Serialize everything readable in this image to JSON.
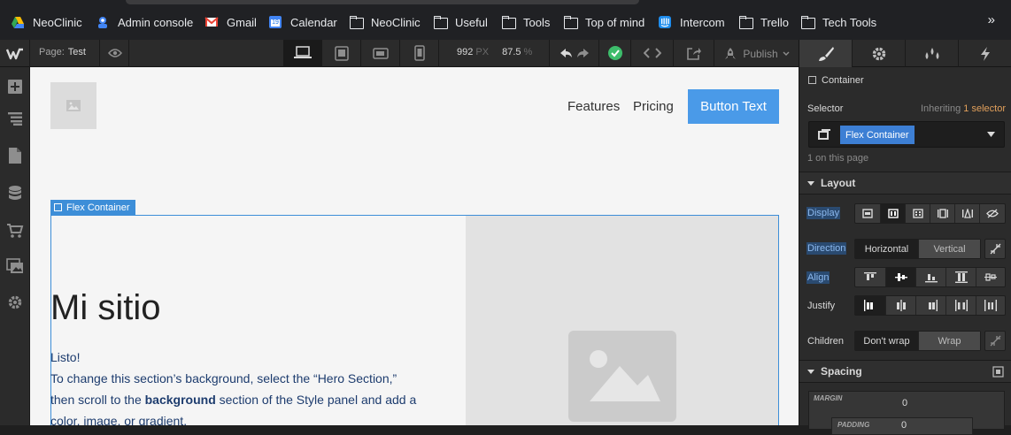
{
  "bookmarks": [
    {
      "label": "NeoClinic",
      "icon": "google-drive-icon"
    },
    {
      "label": "Admin console",
      "icon": "admin-console-icon"
    },
    {
      "label": "Gmail",
      "icon": "gmail-icon"
    },
    {
      "label": "Calendar",
      "icon": "calendar-icon",
      "badge": "19"
    },
    {
      "label": "NeoClinic",
      "icon": "folder-icon"
    },
    {
      "label": "Useful",
      "icon": "folder-icon"
    },
    {
      "label": "Tools",
      "icon": "folder-icon"
    },
    {
      "label": "Top of mind",
      "icon": "folder-icon"
    },
    {
      "label": "Intercom",
      "icon": "intercom-icon"
    },
    {
      "label": "Trello",
      "icon": "folder-icon"
    },
    {
      "label": "Tech Tools",
      "icon": "folder-icon"
    }
  ],
  "bookmarks_more": "»",
  "toolbar": {
    "page_label": "Page:",
    "page_name": "Test",
    "width_value": "992",
    "width_unit": "PX",
    "zoom_value": "87.5",
    "zoom_unit": "%",
    "publish_label": "Publish"
  },
  "canvas": {
    "nav_links": [
      "Features",
      "Pricing"
    ],
    "button_text": "Button Text",
    "selected_tag": "Flex Container",
    "hero_title": "Mi sitio",
    "hero_line1": "Listo!",
    "hero_line2": "To change this section’s background, select the “Hero Section,”",
    "hero_line3a": "then scroll to the ",
    "hero_line3b": "background",
    "hero_line3c": " section of the Style panel and add a",
    "hero_line4": "color, image, or gradient."
  },
  "style_panel": {
    "element_label": "Container",
    "selector_label": "Selector",
    "inheriting_label": "Inheriting",
    "inheriting_count": "1 selector",
    "selector_chip": "Flex Container",
    "on_page": "1 on this page",
    "layout_header": "Layout",
    "display_label": "Display",
    "direction_label": "Direction",
    "direction_options": [
      "Horizontal",
      "Vertical"
    ],
    "align_label": "Align",
    "justify_label": "Justify",
    "children_label": "Children",
    "children_options": [
      "Don't wrap",
      "Wrap"
    ],
    "spacing_header": "Spacing",
    "margin_label": "MARGIN",
    "margin_value": "0",
    "padding_label": "PADDING",
    "padding_value": "0"
  },
  "colors": {
    "accent": "#3d8ed8",
    "button": "#4a9ae8",
    "panel": "#2b2b2b",
    "canvas": "#f5f5f5",
    "publish_check": "#3dbd6b"
  }
}
